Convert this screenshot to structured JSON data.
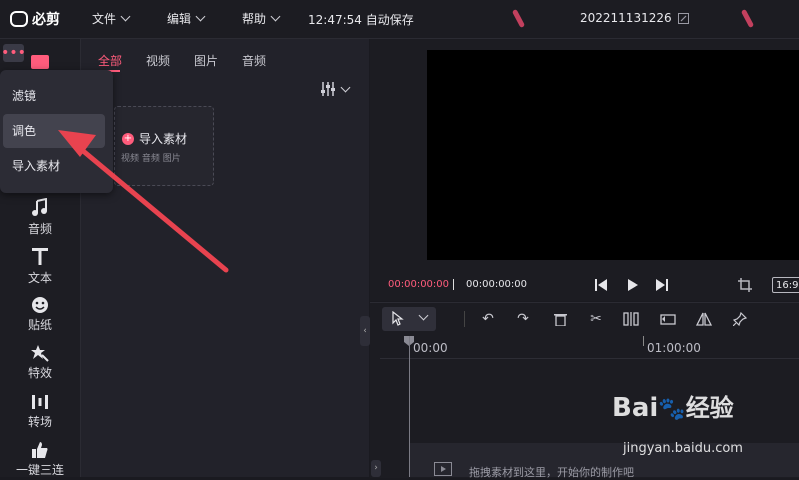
{
  "app": {
    "logo_text": "必剪"
  },
  "topbar": {
    "menus": [
      {
        "label": "文件"
      },
      {
        "label": "编辑"
      },
      {
        "label": "帮助"
      }
    ],
    "autosave_status": "12:47:54 自动保存",
    "project_title": "202211131226"
  },
  "sidebar_tools": [
    {
      "label": "音频",
      "icon": "music-icon"
    },
    {
      "label": "文本",
      "icon": "text-icon"
    },
    {
      "label": "贴纸",
      "icon": "sticker-icon"
    },
    {
      "label": "特效",
      "icon": "effect-icon"
    },
    {
      "label": "转场",
      "icon": "transition-icon"
    },
    {
      "label": "一键三连",
      "icon": "thumbs-up-icon"
    }
  ],
  "dropdown": {
    "items": [
      {
        "label": "滤镜"
      },
      {
        "label": "调色",
        "selected": true
      },
      {
        "label": "导入素材"
      }
    ]
  },
  "media": {
    "tabs": [
      {
        "label": "全部",
        "active": true
      },
      {
        "label": "视频"
      },
      {
        "label": "图片"
      },
      {
        "label": "音频"
      }
    ],
    "import_label": "导入素材",
    "import_hint": "视频 音频 图片"
  },
  "preview": {
    "current_time": "00:00:00:00",
    "total_time": "00:00:00:00",
    "aspect_ratio": "16:9"
  },
  "timeline": {
    "ruler_start": "00:00",
    "ruler_mark": "01:00:00",
    "drop_hint": "拖拽素材到这里，开始你的制作吧"
  },
  "watermark": {
    "brand": "Bai",
    "brand2": "经验",
    "url": "jingyan.baidu.com"
  },
  "colors": {
    "accent": "#ff5c7c",
    "arrow": "#e8434f",
    "deco": "#c2405e"
  }
}
